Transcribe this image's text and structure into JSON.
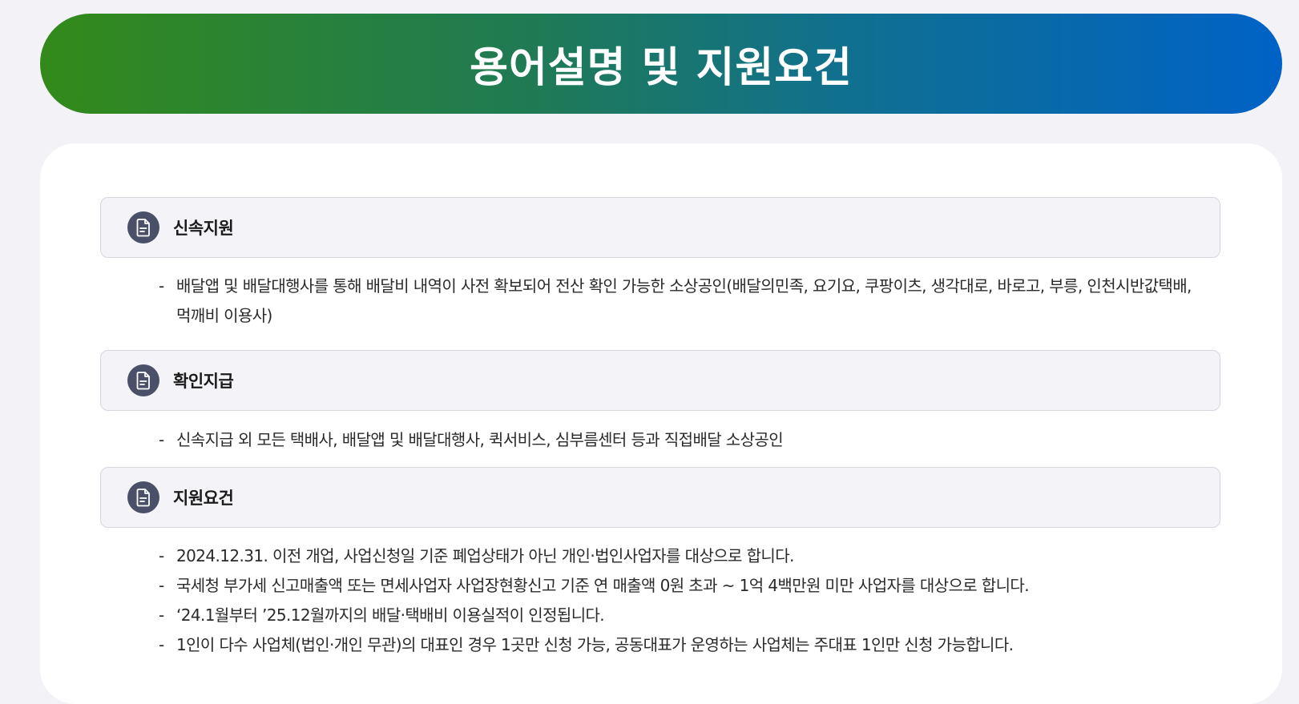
{
  "banner": {
    "title": "용어설명 및 지원요건"
  },
  "sections": [
    {
      "title": "신속지원",
      "icon": "document-icon",
      "bullets": [
        "배달앱 및 배달대행사를 통해 배달비 내역이 사전 확보되어 전산 확인 가능한 소상공인(배달의민족, 요기요, 쿠팡이츠, 생각대로, 바로고, 부릉, 인천시반값택배, 먹깨비 이용사)"
      ]
    },
    {
      "title": "확인지급",
      "icon": "document-icon",
      "bullets": [
        "신속지급 외 모든 택배사, 배달앱 및 배달대행사, 퀵서비스, 심부름센터 등과 직접배달 소상공인"
      ]
    },
    {
      "title": "지원요건",
      "icon": "document-icon",
      "bullets": [
        "2024.12.31. 이전 개업, 사업신청일 기준 폐업상태가 아닌 개인·법인사업자를 대상으로 합니다.",
        "국세청 부가세 신고매출액 또는 면세사업자 사업장현황신고 기준 연 매출액 0원 초과 ~ 1억 4백만원 미만 사업자를 대상으로 합니다.",
        "‘24.1월부터 ’25.12월까지의 배달·택배비 이용실적이 인정됩니다.",
        "1인이 다수 사업체(법인·개인 무관)의 대표인 경우 1곳만 신청 가능, 공동대표가 운영하는 사업체는 주대표 1인만 신청 가능합니다."
      ]
    }
  ],
  "bullet_marker": "-",
  "colors": {
    "banner_gradient_start": "#338a1a",
    "banner_gradient_end": "#0062c6",
    "icon_background": "#4a5068",
    "page_background": "#f3f3f7"
  }
}
